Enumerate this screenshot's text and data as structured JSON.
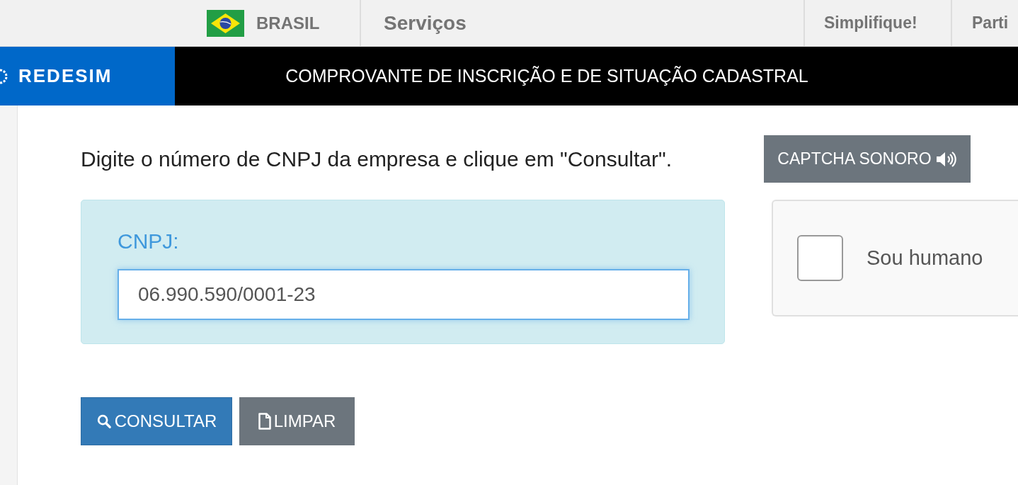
{
  "top_nav": {
    "country": "BRASIL",
    "items": [
      {
        "label": "Serviços"
      },
      {
        "label": "Simplifique!"
      },
      {
        "label": "Parti"
      }
    ]
  },
  "header": {
    "logo": "REDESIM",
    "title": "COMPROVANTE DE INSCRIÇÃO E DE SITUAÇÃO CADASTRAL"
  },
  "instruction": "Digite o número de CNPJ da empresa e clique em \"Consultar\".",
  "captcha_audio_button": "CAPTCHA SONORO",
  "cnpj_field": {
    "label": "CNPJ:",
    "value": "06.990.590/0001-23"
  },
  "captcha": {
    "label": "Sou humano",
    "checked": false
  },
  "buttons": [
    {
      "label": "CONSULTAR",
      "kind": "primary"
    },
    {
      "label": "LIMPAR",
      "kind": "secondary"
    }
  ]
}
